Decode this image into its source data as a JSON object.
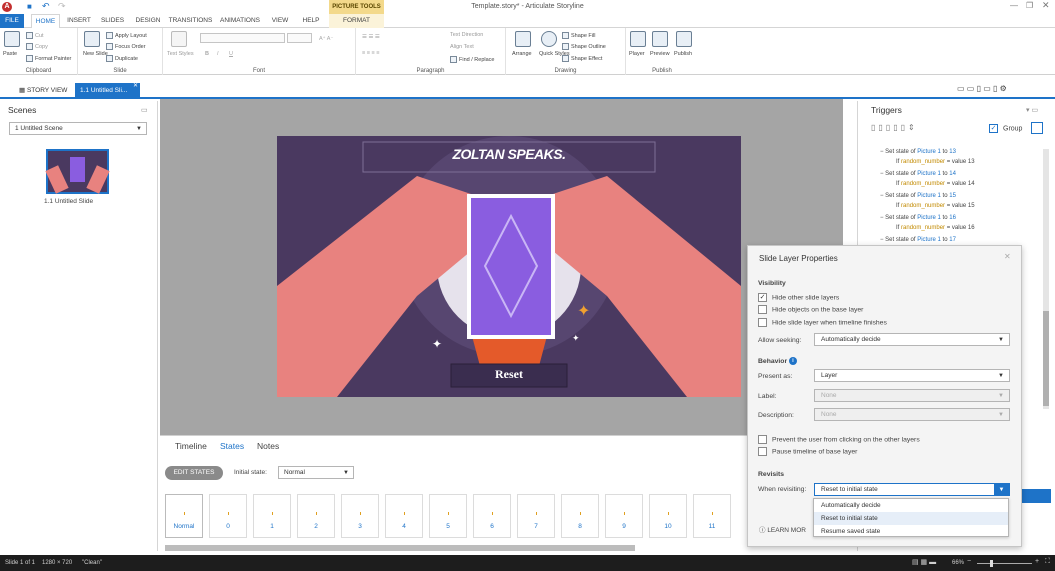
{
  "window": {
    "title": "Template.story* - Articulate Storyline",
    "contextual_tab_group": "PICTURE TOOLS"
  },
  "ribbon_tabs": [
    "FILE",
    "HOME",
    "INSERT",
    "SLIDES",
    "DESIGN",
    "TRANSITIONS",
    "ANIMATIONS",
    "VIEW",
    "HELP",
    "FORMAT"
  ],
  "ribbon": {
    "clipboard": {
      "label": "Clipboard",
      "paste": "Paste",
      "cut": "Cut",
      "copy": "Copy",
      "format_painter": "Format Painter"
    },
    "slide": {
      "label": "Slide",
      "new_slide": "New Slide",
      "apply_layout": "Apply Layout",
      "focus_order": "Focus Order",
      "duplicate": "Duplicate"
    },
    "font": {
      "label": "Font",
      "text_styles": "Text Styles"
    },
    "paragraph": {
      "label": "Paragraph",
      "text_direction": "Text Direction",
      "align_text": "Align Text",
      "find_replace": "Find / Replace"
    },
    "drawing": {
      "label": "Drawing",
      "arrange": "Arrange",
      "quick_styles": "Quick Styles",
      "shape_fill": "Shape Fill",
      "shape_outline": "Shape Outline",
      "shape_effect": "Shape Effect"
    },
    "publish": {
      "label": "Publish",
      "player": "Player",
      "preview": "Preview",
      "publish": "Publish"
    }
  },
  "view_tabs": {
    "story_view": "STORY VIEW",
    "slide_tab": "1.1 Untitled Sli..."
  },
  "scenes": {
    "header": "Scenes",
    "selected_scene": "1 Untitled Scene",
    "thumb_label": "1.1 Untitled Slide"
  },
  "slide": {
    "title": "ZOLTAN SPEAKS.",
    "button": "Reset"
  },
  "bottom_panel": {
    "tabs": [
      "Timeline",
      "States",
      "Notes"
    ],
    "edit_states": "EDIT STATES",
    "initial_state_label": "Initial state:",
    "initial_state_value": "Normal",
    "states": [
      "Normal",
      "0",
      "1",
      "2",
      "3",
      "4",
      "5",
      "6",
      "7",
      "8",
      "9",
      "10",
      "11"
    ]
  },
  "triggers": {
    "header": "Triggers",
    "group_label": "Group",
    "items": [
      {
        "action": "Set state of ",
        "object": "Picture 1",
        "mid": " to ",
        "value": "13",
        "cond_prefix": "If ",
        "var": "random_number",
        "cond": " = value 13"
      },
      {
        "action": "Set state of ",
        "object": "Picture 1",
        "mid": " to ",
        "value": "14",
        "cond_prefix": "If ",
        "var": "random_number",
        "cond": " = value 14"
      },
      {
        "action": "Set state of ",
        "object": "Picture 1",
        "mid": " to ",
        "value": "15",
        "cond_prefix": "If ",
        "var": "random_number",
        "cond": " = value 15"
      },
      {
        "action": "Set state of ",
        "object": "Picture 1",
        "mid": " to ",
        "value": "16",
        "cond_prefix": "If ",
        "var": "random_number",
        "cond": " = value 16"
      },
      {
        "action": "Set state of ",
        "object": "Picture 1",
        "mid": " to ",
        "value": "17",
        "cond_prefix": "",
        "var": "",
        "cond": ""
      }
    ]
  },
  "dialog": {
    "title": "Slide Layer Properties",
    "visibility_header": "Visibility",
    "hide_other_layers": "Hide other slide layers",
    "hide_base_objects": "Hide objects on the base layer",
    "hide_when_finishes": "Hide slide layer when timeline finishes",
    "allow_seeking_label": "Allow seeking:",
    "allow_seeking_value": "Automatically decide",
    "behavior_header": "Behavior",
    "present_as_label": "Present as:",
    "present_as_value": "Layer",
    "label_label": "Label:",
    "label_value": "None",
    "description_label": "Description:",
    "description_value": "None",
    "prevent_click": "Prevent the user from clicking on the other layers",
    "pause_timeline": "Pause timeline of base layer",
    "revisits_header": "Revisits",
    "when_revisiting_label": "When revisiting:",
    "when_revisiting_value": "Reset to initial state",
    "options": [
      "Automatically decide",
      "Reset to initial state",
      "Resume saved state"
    ],
    "learn_more": "LEARN MOR"
  },
  "statusbar": {
    "slide": "Slide 1 of 1",
    "size": "1280 × 720",
    "theme": "\"Clean\"",
    "zoom": "66%"
  },
  "colors": {
    "accent": "#1e73c8",
    "slide_bg": "#4a3960",
    "hand": "#e8827f",
    "card": "#8a5de0"
  }
}
